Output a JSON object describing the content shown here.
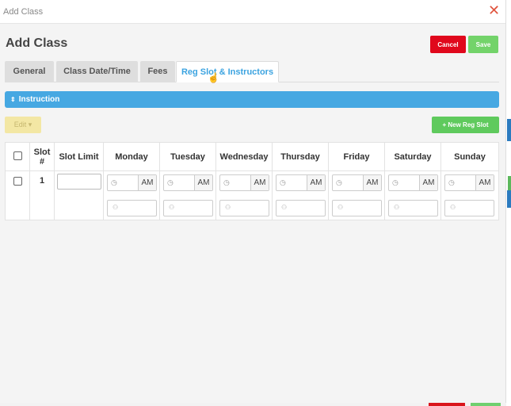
{
  "dialog": {
    "title": "Add Class",
    "close_symbol": "✕"
  },
  "header": {
    "page_title": "Add Class",
    "cancel_label": "Cancel",
    "save_label": "Save"
  },
  "tabs": [
    {
      "label": "General",
      "active": false
    },
    {
      "label": "Class Date/Time",
      "active": false
    },
    {
      "label": "Fees",
      "active": false
    },
    {
      "label": "Reg Slot & Instructors",
      "active": true
    }
  ],
  "section": {
    "title": "Instruction",
    "icon": "sort-chevrons-icon"
  },
  "toolbar": {
    "edit_label": "Edit ▾",
    "new_slot_label": "+ New Reg Slot"
  },
  "table": {
    "headers": [
      "Slot #",
      "Slot Limit",
      "Monday",
      "Tuesday",
      "Wednesday",
      "Thursday",
      "Friday",
      "Saturday",
      "Sunday"
    ],
    "rows": [
      {
        "slot_number": "1",
        "slot_limit": "",
        "days": [
          {
            "day": "Monday",
            "time": "",
            "meridiem": "AM",
            "instructor": ""
          },
          {
            "day": "Tuesday",
            "time": "",
            "meridiem": "AM",
            "instructor": ""
          },
          {
            "day": "Wednesday",
            "time": "",
            "meridiem": "AM",
            "instructor": ""
          },
          {
            "day": "Thursday",
            "time": "",
            "meridiem": "AM",
            "instructor": ""
          },
          {
            "day": "Friday",
            "time": "",
            "meridiem": "AM",
            "instructor": ""
          },
          {
            "day": "Saturday",
            "time": "",
            "meridiem": "AM",
            "instructor": ""
          },
          {
            "day": "Sunday",
            "time": "",
            "meridiem": "AM",
            "instructor": ""
          }
        ]
      }
    ]
  },
  "colors": {
    "accent_blue": "#46a8e2",
    "cancel_red": "#e0081c",
    "save_green": "#73d36a",
    "new_slot_green": "#5fca5d",
    "edit_yellow": "#f3e7a4"
  }
}
